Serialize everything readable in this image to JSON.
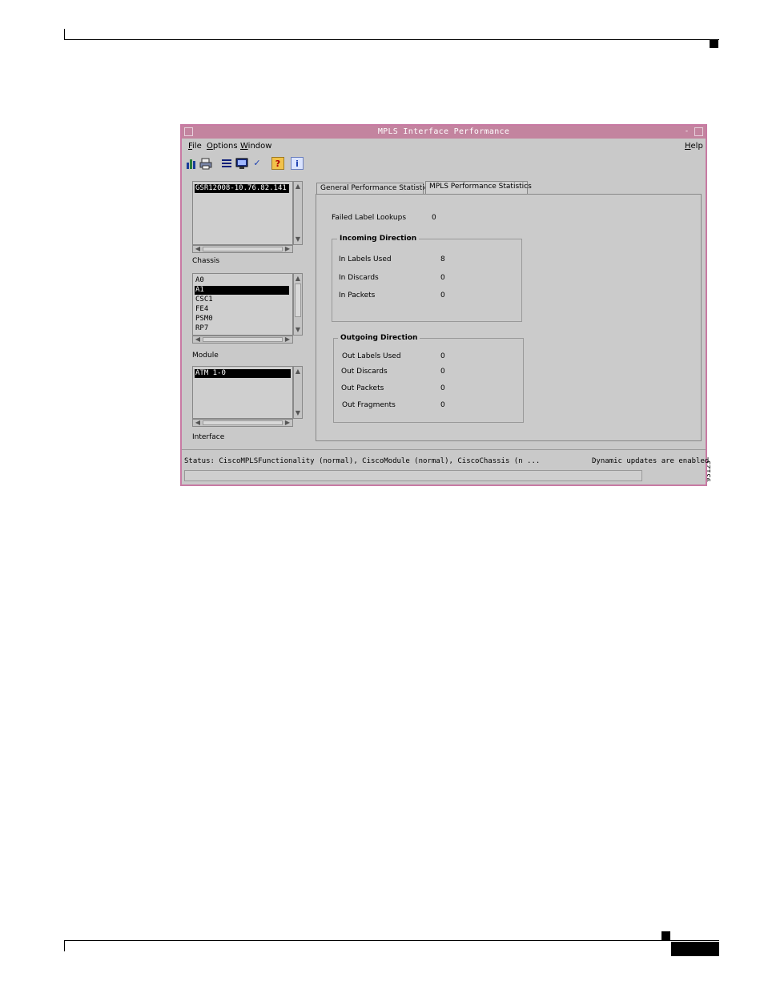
{
  "window": {
    "title": "MPLS Interface Performance",
    "minimize_glyph": "-"
  },
  "menu": {
    "file": {
      "underline": "F",
      "rest": "ile"
    },
    "options": {
      "underline": "O",
      "rest": "ptions"
    },
    "window": {
      "underline": "W",
      "rest": "indow"
    },
    "help": {
      "underline": "H",
      "rest": "elp"
    }
  },
  "toolbar": {
    "icons": [
      "chart-icon",
      "print-icon",
      "list-icon",
      "monitor-icon",
      "check-icon",
      "help-question-icon",
      "info-icon"
    ],
    "glyphs": {
      "check": "✓",
      "question": "?",
      "info": "i"
    }
  },
  "chassis": {
    "label": "Chassis",
    "items": [
      "GSR12008-10.76.82.141"
    ],
    "selected": 0
  },
  "module": {
    "label": "Module",
    "items": [
      "A0",
      "A1",
      "CSC1",
      "FE4",
      "PSM0",
      "RP7"
    ],
    "selected": 1
  },
  "interface": {
    "label": "Interface",
    "items": [
      "ATM 1-0"
    ],
    "selected": 0
  },
  "tabs": [
    {
      "label": "General Performance Statistics",
      "active": false
    },
    {
      "label": "MPLS Performance Statistics",
      "active": true
    }
  ],
  "stats": {
    "failed_label_lookups": {
      "label": "Failed Label Lookups",
      "value": "0"
    },
    "incoming": {
      "title": "Incoming Direction",
      "rows": [
        {
          "label": "In Labels Used",
          "value": "8"
        },
        {
          "label": "In Discards",
          "value": "0"
        },
        {
          "label": "In Packets",
          "value": "0"
        }
      ]
    },
    "outgoing": {
      "title": "Outgoing Direction",
      "rows": [
        {
          "label": "Out Labels Used",
          "value": "0"
        },
        {
          "label": "Out Discards",
          "value": "0"
        },
        {
          "label": "Out Packets",
          "value": "0"
        },
        {
          "label": "Out Fragments",
          "value": "0"
        }
      ]
    }
  },
  "status": {
    "text": "Status: CiscoMPLSFunctionality (normal), CiscoModule (normal), CiscoChassis (n ...",
    "updates": "Dynamic updates are enabled"
  },
  "figure_id": "93125",
  "colors": {
    "window_border": "#c87aa3",
    "title_bar": "#c3849f",
    "background": "#c9c9c9",
    "selection": "#000000"
  }
}
